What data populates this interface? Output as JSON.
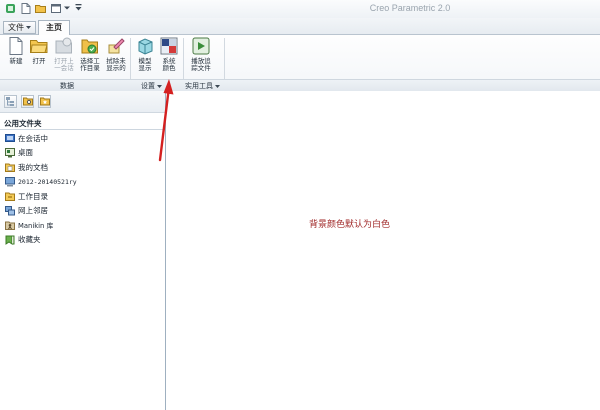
{
  "app": {
    "title": "Creo Parametric 2.0"
  },
  "tabs": {
    "file_menu": "文件",
    "home": "主页"
  },
  "ribbon": {
    "buttons": [
      {
        "id": "new",
        "label": "新建",
        "icon": "new-file-icon",
        "enabled": true
      },
      {
        "id": "open",
        "label": "打开",
        "icon": "open-folder-icon",
        "enabled": true
      },
      {
        "id": "open-last",
        "label": "打开上\n一会话",
        "icon": "open-last-session-icon",
        "enabled": false
      },
      {
        "id": "select-workdir",
        "label": "选择工\n作目录",
        "icon": "select-working-directory-icon",
        "enabled": true
      },
      {
        "id": "erase",
        "label": "拭除未\n显示的",
        "icon": "erase-not-displayed-icon",
        "enabled": true
      },
      {
        "id": "model-display",
        "label": "模型\n显示",
        "icon": "model-display-icon",
        "enabled": true
      },
      {
        "id": "system-colors",
        "label": "系统\n颜色",
        "icon": "system-colors-icon",
        "enabled": true
      },
      {
        "id": "play-trail",
        "label": "播放追\n踪文件",
        "icon": "play-trail-file-icon",
        "enabled": true
      }
    ],
    "groups": {
      "data": "数据",
      "settings": "设置",
      "utilities": "实用工具"
    }
  },
  "left_panel": {
    "header": "公用文件夹",
    "items": [
      {
        "label": "在会话中",
        "icon": "in-session-icon"
      },
      {
        "label": "桌面",
        "icon": "desktop-icon"
      },
      {
        "label": "我的文档",
        "icon": "my-documents-icon"
      },
      {
        "label": "2012-20140521ry",
        "icon": "computer-icon"
      },
      {
        "label": "工作目录",
        "icon": "working-directory-icon"
      },
      {
        "label": "网上邻居",
        "icon": "network-icon"
      },
      {
        "label": "Manikin 库",
        "icon": "manikin-library-icon"
      },
      {
        "label": "收藏夹",
        "icon": "favorites-icon"
      }
    ]
  },
  "main": {
    "annotation": "背景颜色默认为白色"
  },
  "colors": {
    "annotation": "#a12a2a",
    "arrow": "#d42020"
  }
}
